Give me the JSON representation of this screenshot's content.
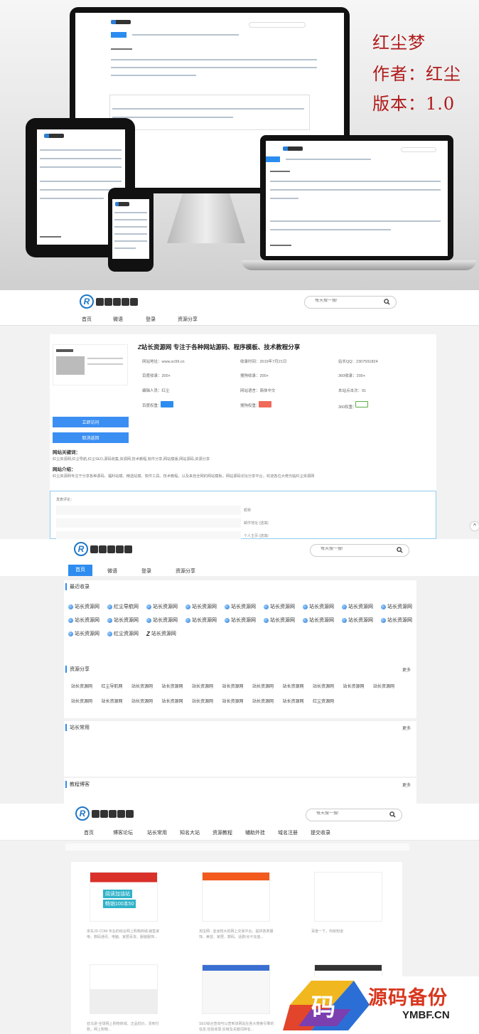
{
  "promo": {
    "line1": "红尘梦",
    "line2": "作者：红尘",
    "line3": "版本：1.0"
  },
  "header": {
    "search_placeholder": "每天搜一搜!"
  },
  "detail": {
    "nav": [
      "首页",
      "微语",
      "登录",
      "资源分享"
    ],
    "site_title": "站长资源网  专注于各种网站源码、程序模板、技术教程分享",
    "fields": [
      "网站地址：www.sc99.cn",
      "收录时间：2019年7月21日",
      "站长QQ：2307591824",
      "百度收录：200+",
      "搜狗收录：200+",
      "360收录：200+",
      "编辑人员：红尘",
      "网站语言：简体中文",
      "本站点击次：91",
      "百度权重：",
      "搜狗权重：",
      "360权重："
    ],
    "btn_visit": "立即访问",
    "btn_cancel": "取消返回",
    "keywords_label": "网站关键词：",
    "keywords": "红尘资源网,红尘导航,红尘SEO,源码收集,资源网,技术教程,软件分享,网站模版,网站源码,资源分享",
    "intro_label": "网站介绍：",
    "intro": "红尘资源网专注于分享各种源码、福利站模、精选站模、软件工具、技术教程，以及来自全网的网站模板，网站源码论坛分享平台，欢迎各位大佬光临红尘资源网",
    "comment_label": "发表评论：",
    "comment_fields": [
      "昵称",
      "邮件地址 (选填)",
      "个人主页 (选填)"
    ]
  },
  "home": {
    "nav": [
      "首页",
      "微语",
      "登录",
      "资源分享"
    ],
    "recent_title": "最近收录",
    "recent_items": [
      "站长资源网",
      "红尘导航网",
      "站长资源网",
      "站长资源网",
      "站长资源网",
      "站长资源网",
      "站长资源网",
      "站长资源网",
      "站长资源网",
      "站长资源网",
      "站长资源网",
      "站长资源网",
      "站长资源网",
      "站长资源网",
      "站长资源网",
      "站长资源网",
      "站长资源网",
      "站长资源网",
      "站长资源网",
      "红尘资源网",
      "站长资源网"
    ],
    "share_title": "资源分享",
    "share_items": [
      "站长资源网",
      "红尘导航网",
      "站长资源网",
      "站长资源网",
      "站长资源网",
      "站长资源网",
      "站长资源网",
      "站长资源网",
      "站长资源网",
      "站长资源网",
      "站长资源网",
      "站长资源网",
      "站长资源网",
      "站长资源网",
      "站长资源网",
      "站长资源网",
      "站长资源网",
      "站长资源网",
      "站长资源网",
      "红尘资源网"
    ],
    "tools_title": "站长常用",
    "blog_title": "教程博客",
    "more": "更多"
  },
  "blog": {
    "nav": [
      "首页",
      "博客论坛",
      "站长常用",
      "知名大站",
      "资源教程",
      "辅助外挂",
      "域名注册",
      "提交收录"
    ],
    "captions": [
      "京东JD.COM-专业的综合网上购物商城,销售家电、数码通讯、电脑、家居百货、服装服饰...",
      "淘宝网 - 亚洲较大的网上交易平台，提供各类服饰、美容、家居、数码、话费/点卡充值...",
      "百度一下，你就知道",
      "亚马逊-全球网上购物商城，正品低价，货到付款，网上购物...",
      "SEO综合查询可以查到该网站在各大搜索引擎的信息,包括收录,反链及关键词排名...",
      "以及国内领先的搜索引擎,以中文搜索为..."
    ],
    "thumb_texts": [
      "阅读加油站",
      "畅销100本50"
    ]
  },
  "watermark": {
    "title": "源码备份",
    "domain": "YMBF.CN",
    "glyph": "码"
  },
  "colors": {
    "accent": "#2d8cf0",
    "promo_red": "#b01a1a"
  }
}
